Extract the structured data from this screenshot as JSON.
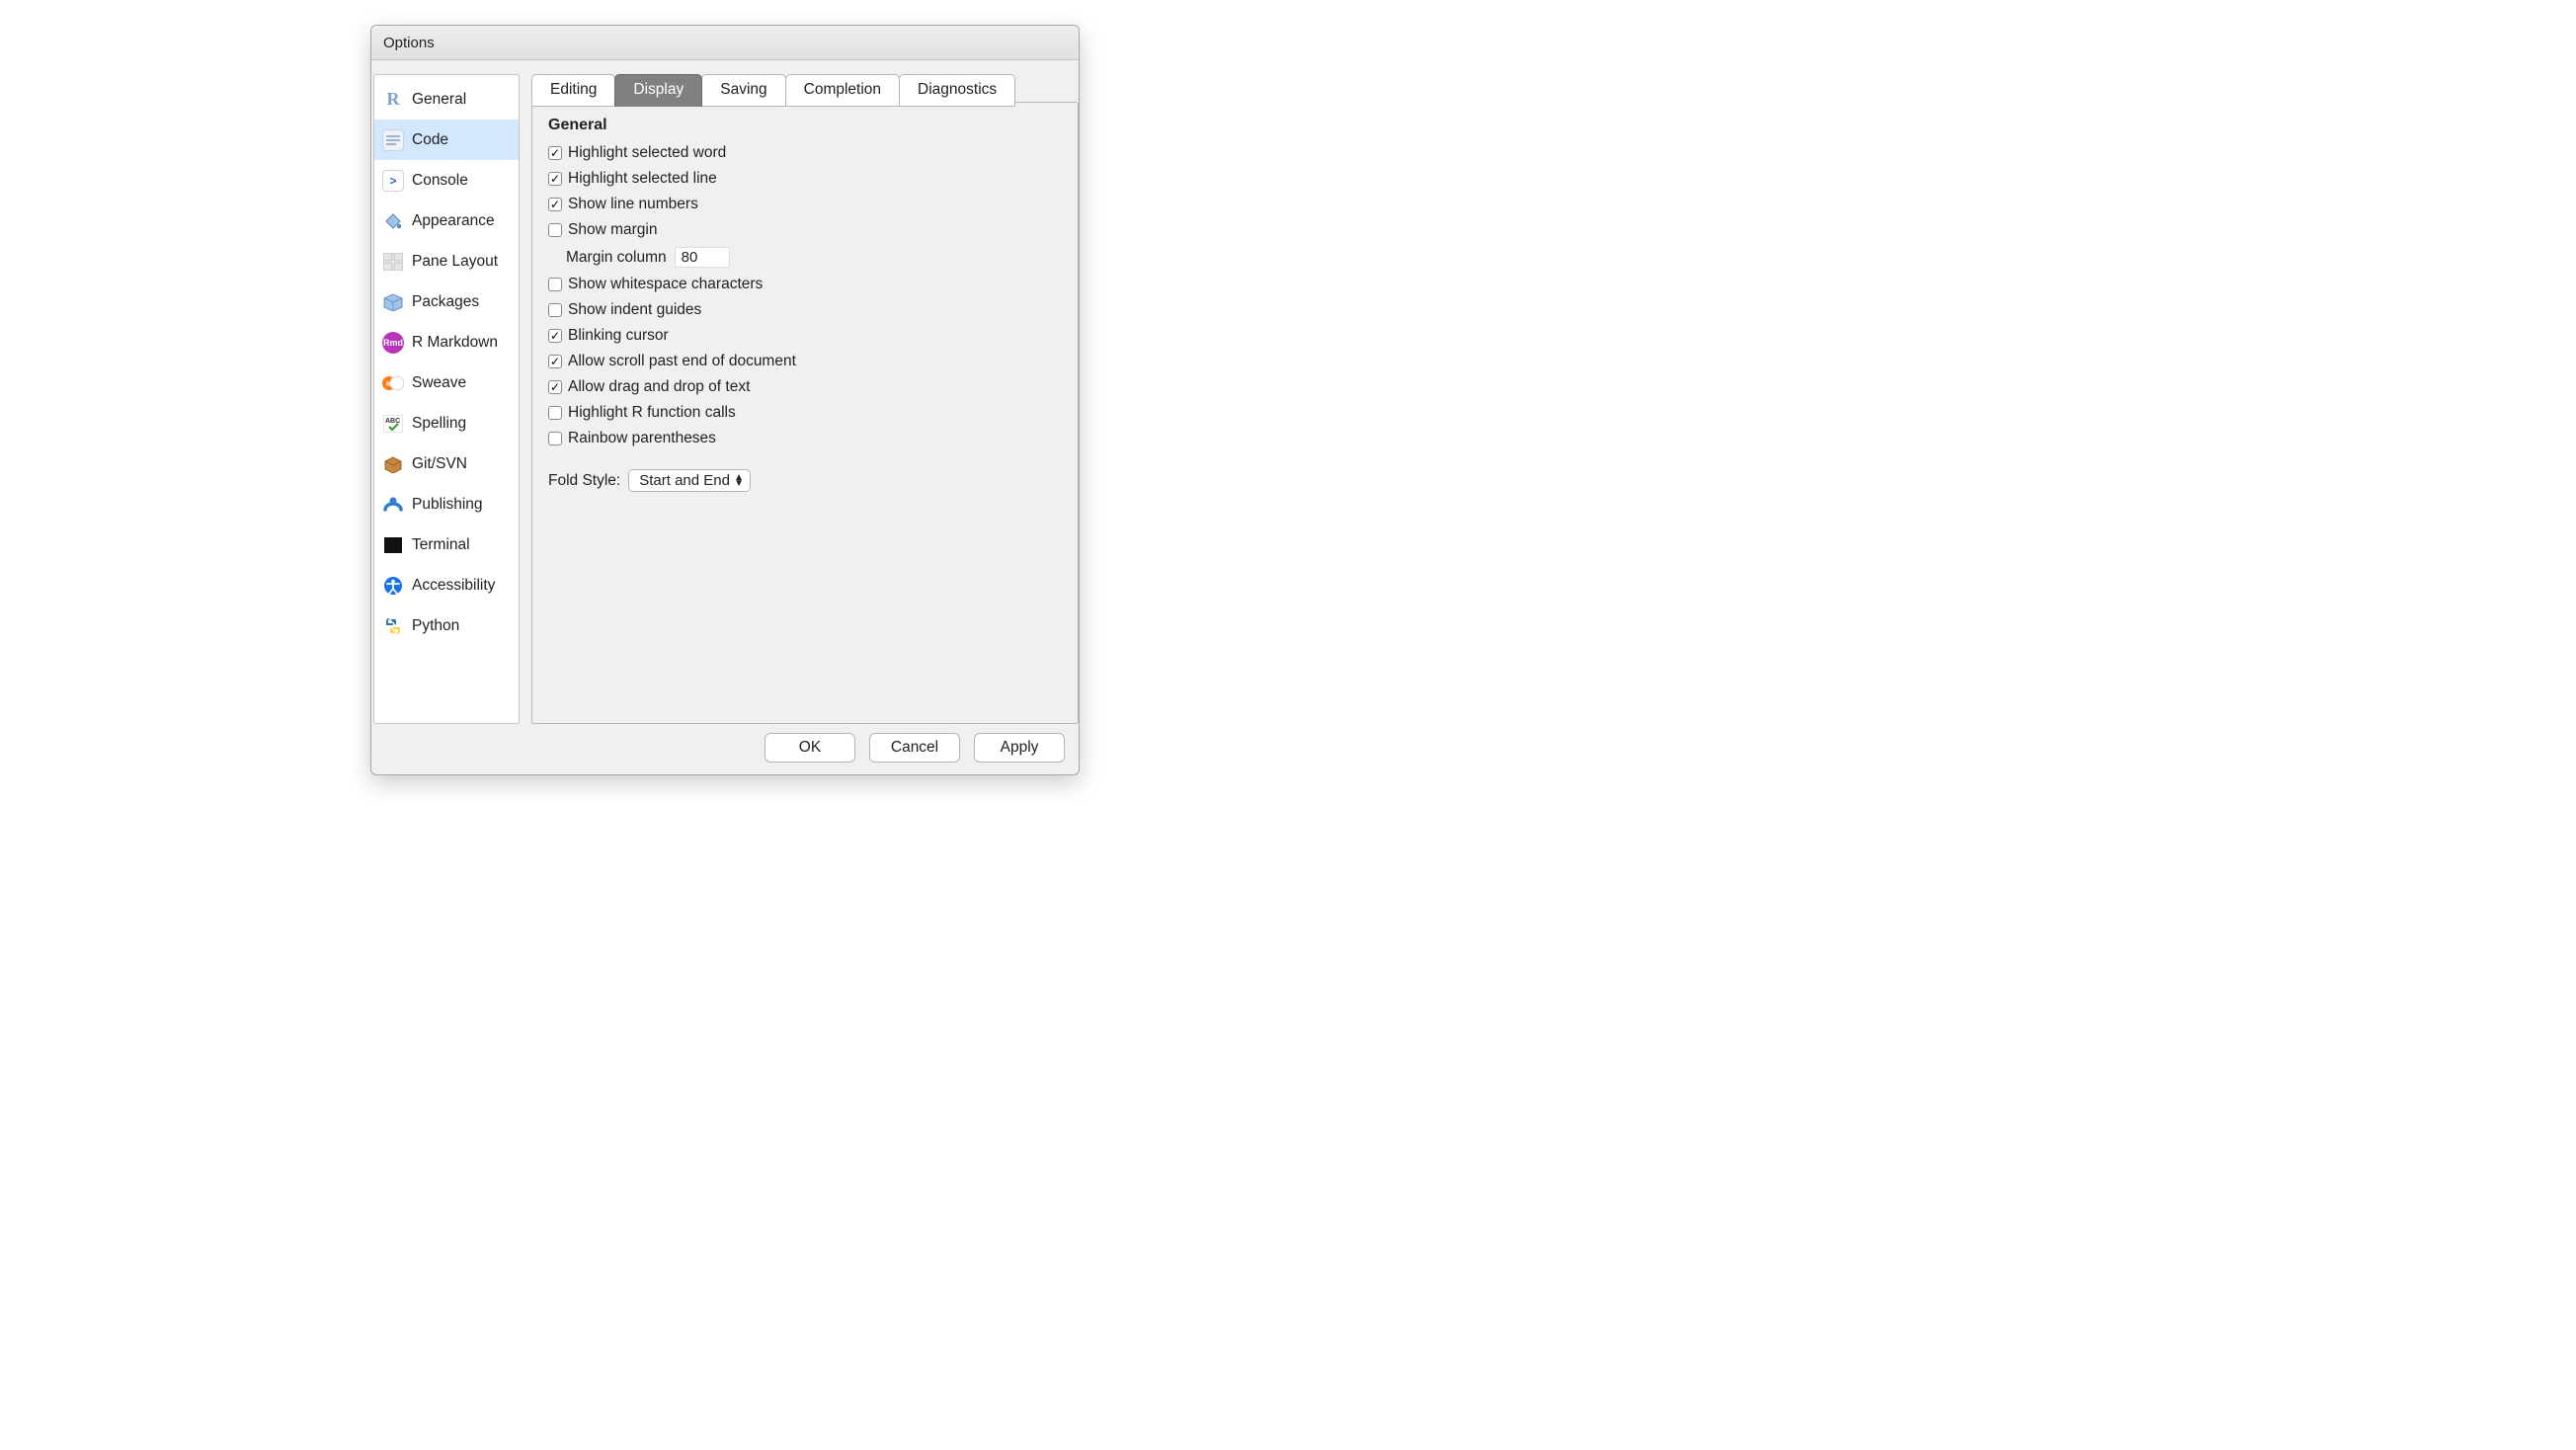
{
  "window": {
    "title": "Options"
  },
  "sidebar": {
    "items": [
      {
        "label": "General"
      },
      {
        "label": "Code"
      },
      {
        "label": "Console"
      },
      {
        "label": "Appearance"
      },
      {
        "label": "Pane Layout"
      },
      {
        "label": "Packages"
      },
      {
        "label": "R Markdown"
      },
      {
        "label": "Sweave"
      },
      {
        "label": "Spelling"
      },
      {
        "label": "Git/SVN"
      },
      {
        "label": "Publishing"
      },
      {
        "label": "Terminal"
      },
      {
        "label": "Accessibility"
      },
      {
        "label": "Python"
      }
    ],
    "active_index": 1
  },
  "tabs": {
    "items": [
      {
        "label": "Editing"
      },
      {
        "label": "Display"
      },
      {
        "label": "Saving"
      },
      {
        "label": "Completion"
      },
      {
        "label": "Diagnostics"
      }
    ],
    "active_index": 1
  },
  "panel": {
    "section_title": "General",
    "checkboxes": [
      {
        "label": "Highlight selected word",
        "checked": true
      },
      {
        "label": "Highlight selected line",
        "checked": true
      },
      {
        "label": "Show line numbers",
        "checked": true
      },
      {
        "label": "Show margin",
        "checked": false
      },
      {
        "label": "Show whitespace characters",
        "checked": false
      },
      {
        "label": "Show indent guides",
        "checked": false
      },
      {
        "label": "Blinking cursor",
        "checked": true
      },
      {
        "label": "Allow scroll past end of document",
        "checked": true
      },
      {
        "label": "Allow drag and drop of text",
        "checked": true
      },
      {
        "label": "Highlight R function calls",
        "checked": false
      },
      {
        "label": "Rainbow parentheses",
        "checked": false
      }
    ],
    "margin_column": {
      "label": "Margin column",
      "value": "80"
    },
    "fold_style": {
      "label": "Fold Style:",
      "value": "Start and End"
    }
  },
  "buttons": {
    "ok": "OK",
    "cancel": "Cancel",
    "apply": "Apply"
  }
}
